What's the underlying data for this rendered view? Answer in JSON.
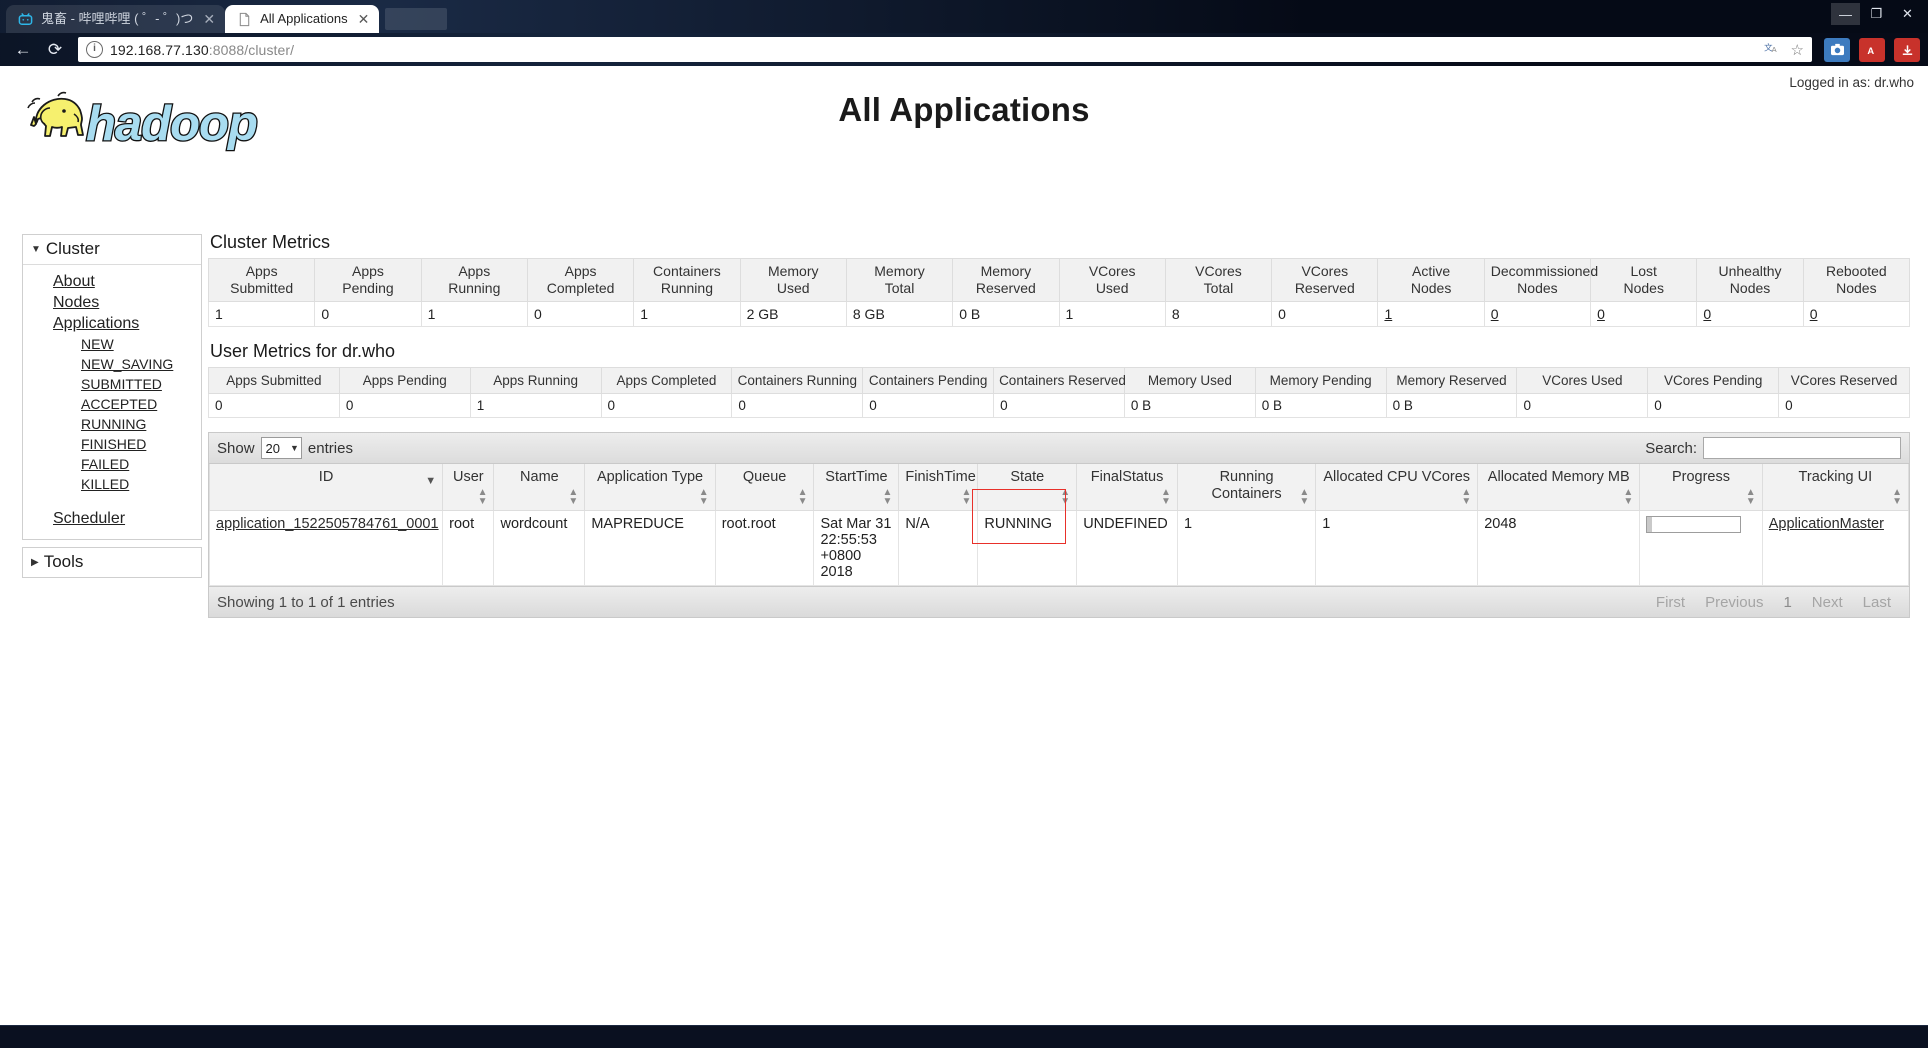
{
  "browser": {
    "tabs": [
      {
        "title": "鬼畜 - 哔哩哔哩 ( ゜- ゜)つ",
        "favicon": "bilibili-icon",
        "active": false,
        "close": "✕"
      },
      {
        "title": "All Applications",
        "favicon": "page-icon",
        "active": true,
        "close": "✕"
      }
    ],
    "window_controls": {
      "minimize": "—",
      "maximize": "❐",
      "close": "✕"
    },
    "nav": {
      "back": "←",
      "forward": "→",
      "reload": "⟳"
    },
    "url": {
      "scheme_info": "ⓘ",
      "host": "192.168.77.130",
      "port_path": ":8088/cluster/"
    },
    "url_right": {
      "translate": "translate-icon",
      "bookmark": "☆"
    },
    "extensions": [
      {
        "name": "screenshot-extension-icon",
        "glyph": "▣",
        "color": "#3d7bbf"
      },
      {
        "name": "pdf-extension-icon",
        "glyph": "A",
        "color": "#c8322b"
      },
      {
        "name": "download-extension-icon",
        "glyph": "↓",
        "color": "#c8322b"
      }
    ]
  },
  "header": {
    "logo_alt": "hadoop",
    "page_title": "All Applications",
    "logged_in": "Logged in as: dr.who"
  },
  "sidebar": {
    "cluster_group": {
      "label": "Cluster",
      "items": [
        {
          "label": "About"
        },
        {
          "label": "Nodes"
        },
        {
          "label": "Applications"
        }
      ],
      "app_states": [
        {
          "label": "NEW"
        },
        {
          "label": "NEW_SAVING"
        },
        {
          "label": "SUBMITTED"
        },
        {
          "label": "ACCEPTED"
        },
        {
          "label": "RUNNING"
        },
        {
          "label": "FINISHED"
        },
        {
          "label": "FAILED"
        },
        {
          "label": "KILLED"
        }
      ],
      "scheduler": {
        "label": "Scheduler"
      }
    },
    "tools_group": {
      "label": "Tools"
    }
  },
  "cluster_metrics": {
    "title": "Cluster Metrics",
    "headers": [
      "Apps Submitted",
      "Apps Pending",
      "Apps Running",
      "Apps Completed",
      "Containers Running",
      "Memory Used",
      "Memory Total",
      "Memory Reserved",
      "VCores Used",
      "VCores Total",
      "VCores Reserved",
      "Active Nodes",
      "Decommissioned Nodes",
      "Lost Nodes",
      "Unhealthy Nodes",
      "Rebooted Nodes"
    ],
    "values": [
      "1",
      "0",
      "1",
      "0",
      "1",
      "2 GB",
      "8 GB",
      "0 B",
      "1",
      "8",
      "0",
      "1",
      "0",
      "0",
      "0",
      "0"
    ],
    "link_from_index": 11
  },
  "user_metrics": {
    "title": "User Metrics for dr.who",
    "headers": [
      "Apps Submitted",
      "Apps Pending",
      "Apps Running",
      "Apps Completed",
      "Containers Running",
      "Containers Pending",
      "Containers Reserved",
      "Memory Used",
      "Memory Pending",
      "Memory Reserved",
      "VCores Used",
      "VCores Pending",
      "VCores Reserved"
    ],
    "values": [
      "0",
      "0",
      "1",
      "0",
      "0",
      "0",
      "0",
      "0 B",
      "0 B",
      "0 B",
      "0",
      "0",
      "0"
    ]
  },
  "datatable": {
    "show_label": "Show",
    "page_length": "20",
    "entries_label": "entries",
    "search_label": "Search:",
    "search_value": "",
    "search_placeholder": "",
    "info": "Showing 1 to 1 of 1 entries",
    "paginate": {
      "first": "First",
      "previous": "Previous",
      "page": "1",
      "next": "Next",
      "last": "Last"
    },
    "columns": [
      {
        "label": "ID",
        "sort": "desc"
      },
      {
        "label": "User",
        "sort": "both"
      },
      {
        "label": "Name",
        "sort": "both"
      },
      {
        "label": "Application Type",
        "sort": "both"
      },
      {
        "label": "Queue",
        "sort": "both"
      },
      {
        "label": "StartTime",
        "sort": "both"
      },
      {
        "label": "FinishTime",
        "sort": "both"
      },
      {
        "label": "State",
        "sort": "both"
      },
      {
        "label": "FinalStatus",
        "sort": "both"
      },
      {
        "label": "Running Containers",
        "sort": "both"
      },
      {
        "label": "Allocated CPU VCores",
        "sort": "both"
      },
      {
        "label": "Allocated Memory MB",
        "sort": "both"
      },
      {
        "label": "Progress",
        "sort": "both"
      },
      {
        "label": "Tracking UI",
        "sort": "both"
      }
    ],
    "rows": [
      {
        "id": "application_1522505784761_0001",
        "user": "root",
        "name": "wordcount",
        "app_type": "MAPREDUCE",
        "queue": "root.root",
        "start_time": "Sat Mar 31 22:55:53 +0800 2018",
        "finish_time": "N/A",
        "state": "RUNNING",
        "final_status": "UNDEFINED",
        "running_containers": "1",
        "allocated_cpu_vcores": "1",
        "allocated_memory_mb": "2048",
        "progress": "0",
        "tracking_ui": "ApplicationMaster"
      }
    ]
  },
  "annotation": {
    "color": "#e8302a",
    "target": "state-cell-running"
  }
}
